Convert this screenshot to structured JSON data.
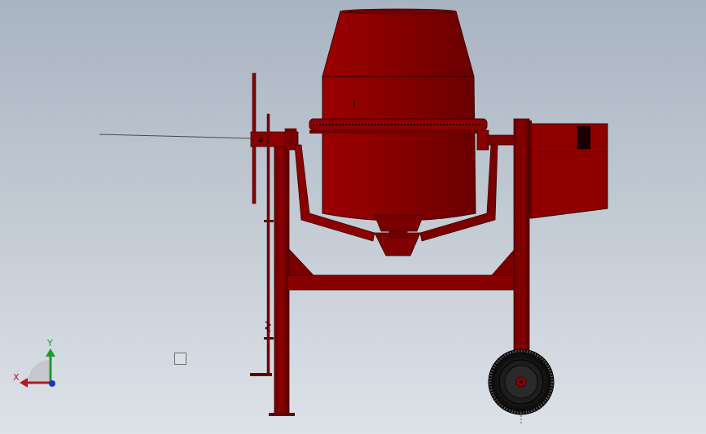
{
  "triad": {
    "x_label": "X",
    "y_label": "Y"
  },
  "colors": {
    "background_top": "#a9b4c2",
    "background_bottom": "#dde2e8",
    "body_red": "#8e0000",
    "dark_red": "#5e0000",
    "tire": "#111111",
    "axis_x": "#c0141c",
    "axis_y": "#1d9a2c",
    "axis_z": "#1a35c8"
  },
  "icons": {
    "triad": "coordinate-triad-icon",
    "selection": "selection-box-icon"
  }
}
